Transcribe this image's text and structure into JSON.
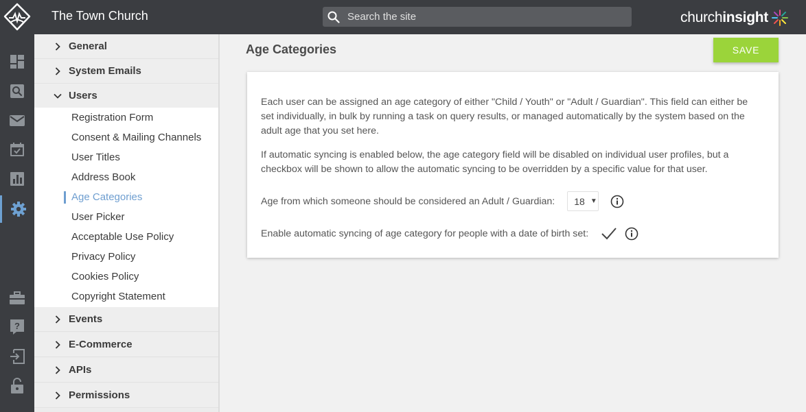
{
  "header": {
    "site_title": "The Town Church",
    "search_placeholder": "Search the site",
    "brand_plain": "church",
    "brand_bold": "insight"
  },
  "rail": {
    "icons": [
      "dashboard-icon",
      "search-icon",
      "mail-icon",
      "calendar-icon",
      "chart-icon",
      "gear-icon",
      "briefcase-icon",
      "help-icon",
      "logout-icon",
      "lock-icon"
    ],
    "active": "gear-icon"
  },
  "subnav": {
    "sections": [
      {
        "label": "General",
        "expanded": false
      },
      {
        "label": "System Emails",
        "expanded": false
      },
      {
        "label": "Users",
        "expanded": true
      },
      {
        "label": "Events",
        "expanded": false
      },
      {
        "label": "E-Commerce",
        "expanded": false
      },
      {
        "label": "APIs",
        "expanded": false
      },
      {
        "label": "Permissions",
        "expanded": false
      }
    ],
    "user_items": [
      {
        "label": "Registration Form"
      },
      {
        "label": "Consent & Mailing Channels"
      },
      {
        "label": "User Titles"
      },
      {
        "label": "Address Book"
      },
      {
        "label": "Age Categories",
        "active": true
      },
      {
        "label": "User Picker"
      },
      {
        "label": "Acceptable Use Policy"
      },
      {
        "label": "Privacy Policy"
      },
      {
        "label": "Cookies Policy"
      },
      {
        "label": "Copyright Statement"
      }
    ]
  },
  "main": {
    "title": "Age Categories",
    "save_label": "SAVE",
    "paragraph1": "Each user can be assigned an age category of either \"Child / Youth\" or \"Adult / Guardian\". This field can either be set individually, in bulk by running a task on query results, or managed automatically by the system based on the adult age that you set here.",
    "paragraph2": "If automatic syncing is enabled below, the age category field will be disabled on individual user profiles, but a checkbox will be shown to allow the automatic syncing to be overridden by a specific value for that user.",
    "adult_age_label": "Age from which someone should be considered an Adult / Guardian:",
    "adult_age_value": "18",
    "sync_label": "Enable automatic syncing of age category for people with a date of birth set:",
    "sync_enabled": true
  },
  "colors": {
    "topbar": "#3b3d41",
    "accent": "#6e9ed0",
    "save": "#9bd43a"
  }
}
